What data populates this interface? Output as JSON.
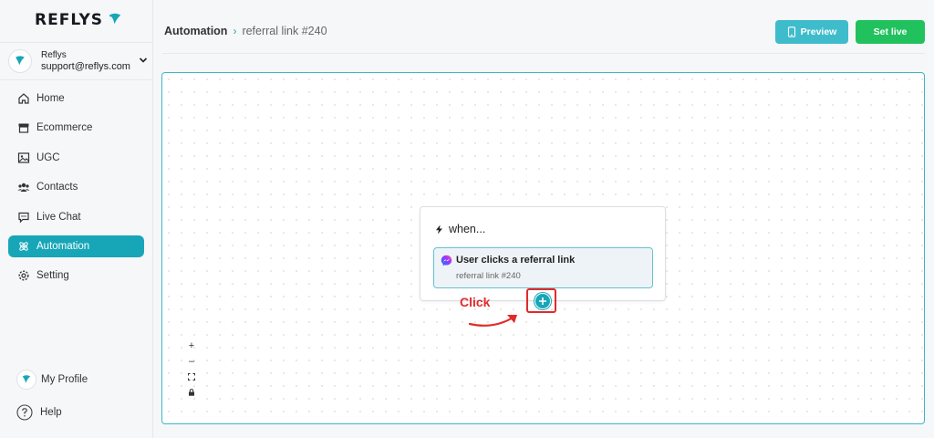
{
  "brand": {
    "name": "REFLYS",
    "color": "#17a6b8"
  },
  "account": {
    "name": "Reflys",
    "email": "support@reflys.com"
  },
  "sidebar": {
    "items": [
      {
        "label": "Home",
        "icon": "home-icon"
      },
      {
        "label": "Ecommerce",
        "icon": "store-icon"
      },
      {
        "label": "UGC",
        "icon": "image-icon"
      },
      {
        "label": "Contacts",
        "icon": "users-icon"
      },
      {
        "label": "Live Chat",
        "icon": "chat-icon"
      },
      {
        "label": "Automation",
        "icon": "automation-icon",
        "active": true
      },
      {
        "label": "Setting",
        "icon": "gear-icon"
      }
    ],
    "profile_label": "My Profile",
    "help_label": "Help"
  },
  "header": {
    "breadcrumb_root": "Automation",
    "breadcrumb_current": "referral link #240",
    "preview_label": "Preview",
    "set_live_label": "Set live"
  },
  "canvas": {
    "node": {
      "heading": "when...",
      "trigger_title": "User clicks a referral link",
      "trigger_subtitle": "referral link #240"
    },
    "annotation": {
      "label": "Click",
      "color": "#e02b2b"
    },
    "controls": [
      "+",
      "–"
    ]
  },
  "colors": {
    "accent": "#17a6b8",
    "preview": "#3fbccb",
    "live": "#21c25e"
  }
}
